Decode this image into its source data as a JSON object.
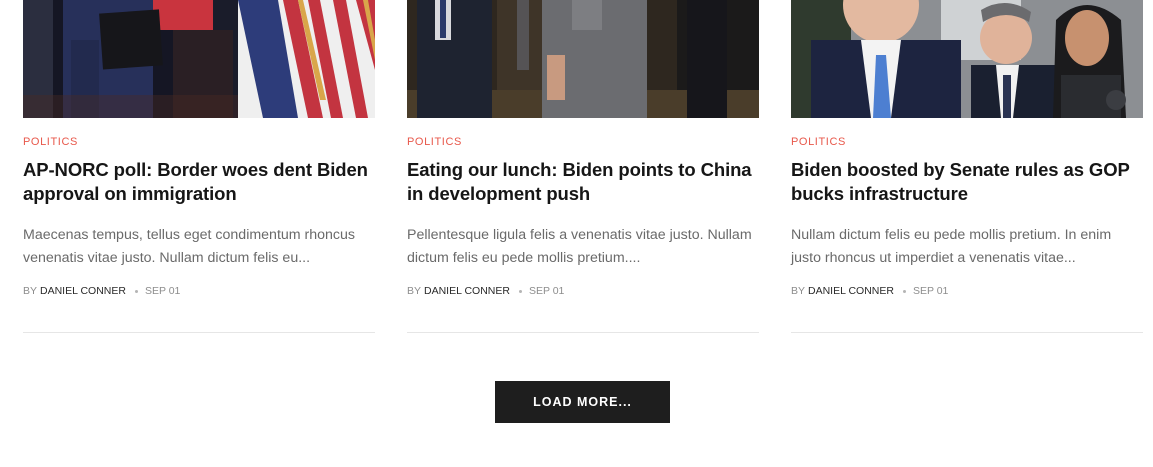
{
  "posts": [
    {
      "category": "POLITICS",
      "title": "AP-NORC poll: Border woes dent Biden approval on immigration",
      "excerpt": "Maecenas tempus, tellus eget condimentum rhoncus venenatis vitae justo. Nullam dictum felis eu...",
      "by": "BY",
      "author": "DANIEL CONNER",
      "date": "SEP 01",
      "image": "Man in suit holding folder beside American flags"
    },
    {
      "category": "POLITICS",
      "title": "Eating our lunch: Biden points to China in development push",
      "excerpt": "Pellentesque ligula felis a venenatis vitae justo. Nullam dictum felis eu pede mollis pretium....",
      "by": "BY",
      "author": "DANIEL CONNER",
      "date": "SEP 01",
      "image": "Men in suits walking through a hallway"
    },
    {
      "category": "POLITICS",
      "title": "Biden boosted by Senate rules as GOP bucks infrastructure",
      "excerpt": "Nullam dictum felis eu pede mollis pretium. In enim justo rhoncus ut imperdiet a venenatis vitae...",
      "by": "BY",
      "author": "DANIEL CONNER",
      "date": "SEP 01",
      "image": "Group of officials standing together outdoors"
    }
  ],
  "load_more_label": "LOAD MORE..."
}
